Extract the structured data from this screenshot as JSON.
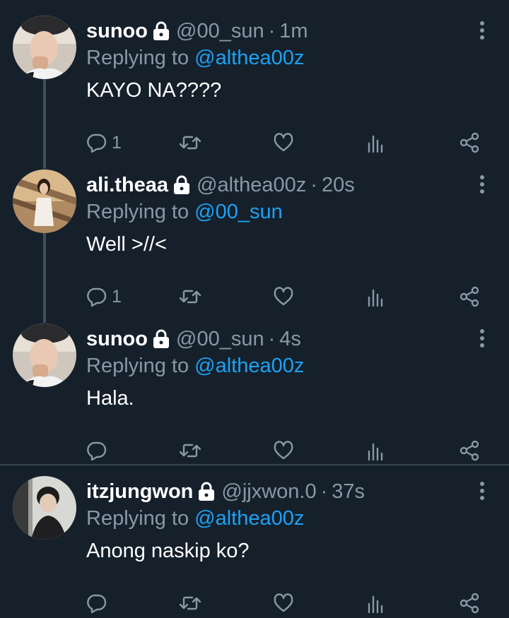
{
  "colors": {
    "background": "#15202b",
    "muted": "#8899a6",
    "link": "#1da1f2",
    "divider": "#38444d"
  },
  "tweets": [
    {
      "name": "sunoo",
      "handle": "@00_sun",
      "separator": "·",
      "time": "1m",
      "replying_prefix": "Replying to ",
      "replying_to": "@althea00z",
      "text": "KAYO NA????",
      "reply_count": "1",
      "icons": [
        "lock-icon",
        "more-icon",
        "reply-icon",
        "retweet-icon",
        "like-icon",
        "analytics-icon",
        "share-icon"
      ]
    },
    {
      "name": "ali.theaa",
      "handle": "@althea00z",
      "separator": "·",
      "time": "20s",
      "replying_prefix": "Replying to ",
      "replying_to": "@00_sun",
      "text": "Well >//<",
      "reply_count": "1"
    },
    {
      "name": "sunoo",
      "handle": "@00_sun",
      "separator": "·",
      "time": "4s",
      "replying_prefix": "Replying to ",
      "replying_to": "@althea00z",
      "text": "Hala.",
      "reply_count": ""
    },
    {
      "name": "itzjungwon",
      "handle": "@jjxwon.0",
      "separator": "·",
      "time": "37s",
      "replying_prefix": "Replying to ",
      "replying_to": "@althea00z",
      "text": "Anong naskip ko?",
      "reply_count": ""
    }
  ]
}
